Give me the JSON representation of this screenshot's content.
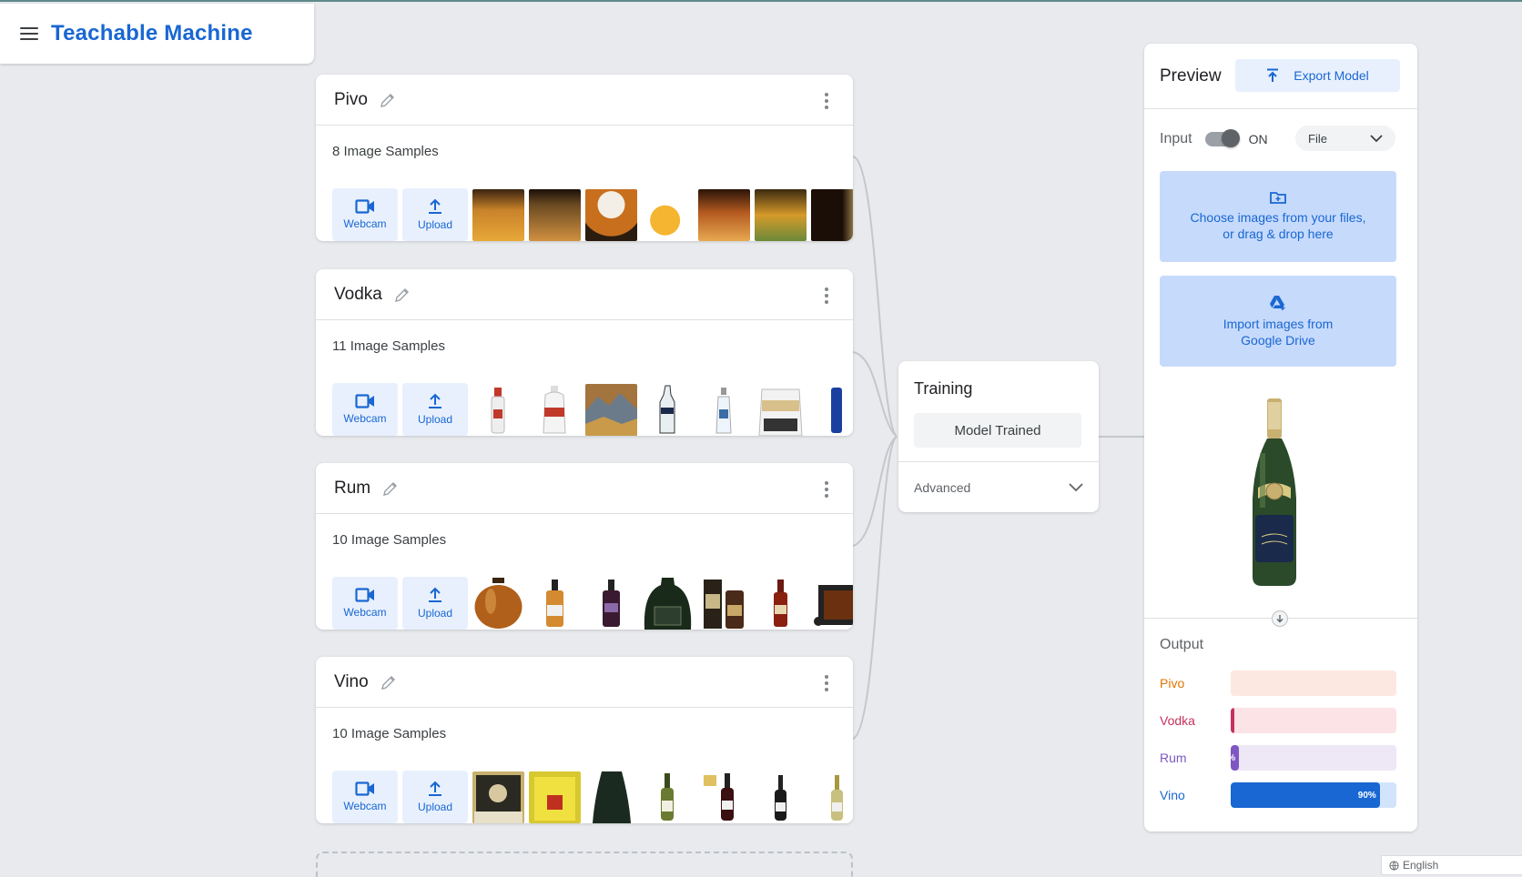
{
  "header": {
    "title": "Teachable Machine"
  },
  "classes": [
    {
      "name": "Pivo",
      "samples_label": "8 Image Samples",
      "webcam_label": "Webcam",
      "upload_label": "Upload"
    },
    {
      "name": "Vodka",
      "samples_label": "11 Image Samples",
      "webcam_label": "Webcam",
      "upload_label": "Upload"
    },
    {
      "name": "Rum",
      "samples_label": "10 Image Samples",
      "webcam_label": "Webcam",
      "upload_label": "Upload"
    },
    {
      "name": "Vino",
      "samples_label": "10 Image Samples",
      "webcam_label": "Webcam",
      "upload_label": "Upload"
    }
  ],
  "training": {
    "title": "Training",
    "button_label": "Model Trained",
    "advanced_label": "Advanced"
  },
  "preview": {
    "title": "Preview",
    "export_label": "Export Model",
    "input_label": "Input",
    "toggle_state": "ON",
    "source_select": "File",
    "drop_files_line1": "Choose images from your files,",
    "drop_files_line2": "or drag & drop here",
    "drive_line1": "Import images from",
    "drive_line2": "Google Drive",
    "output_title": "Output",
    "outputs": [
      {
        "label": "Pivo",
        "value": 0.0,
        "display": "",
        "color": "#e37400",
        "track": "#fce8e0"
      },
      {
        "label": "Vodka",
        "value": 0.02,
        "display": "",
        "color": "#c5325c",
        "track": "#fbe3e6"
      },
      {
        "label": "Rum",
        "value": 0.05,
        "display": "%",
        "color": "#7e57c2",
        "track": "#ede7f6"
      },
      {
        "label": "Vino",
        "value": 0.9,
        "display": "90%",
        "color": "#1967d2",
        "track": "#d2e3fc"
      }
    ]
  },
  "footer": {
    "language": "English"
  },
  "colors": {
    "accent": "#1967d2",
    "accent_light": "#e8f0fe"
  }
}
